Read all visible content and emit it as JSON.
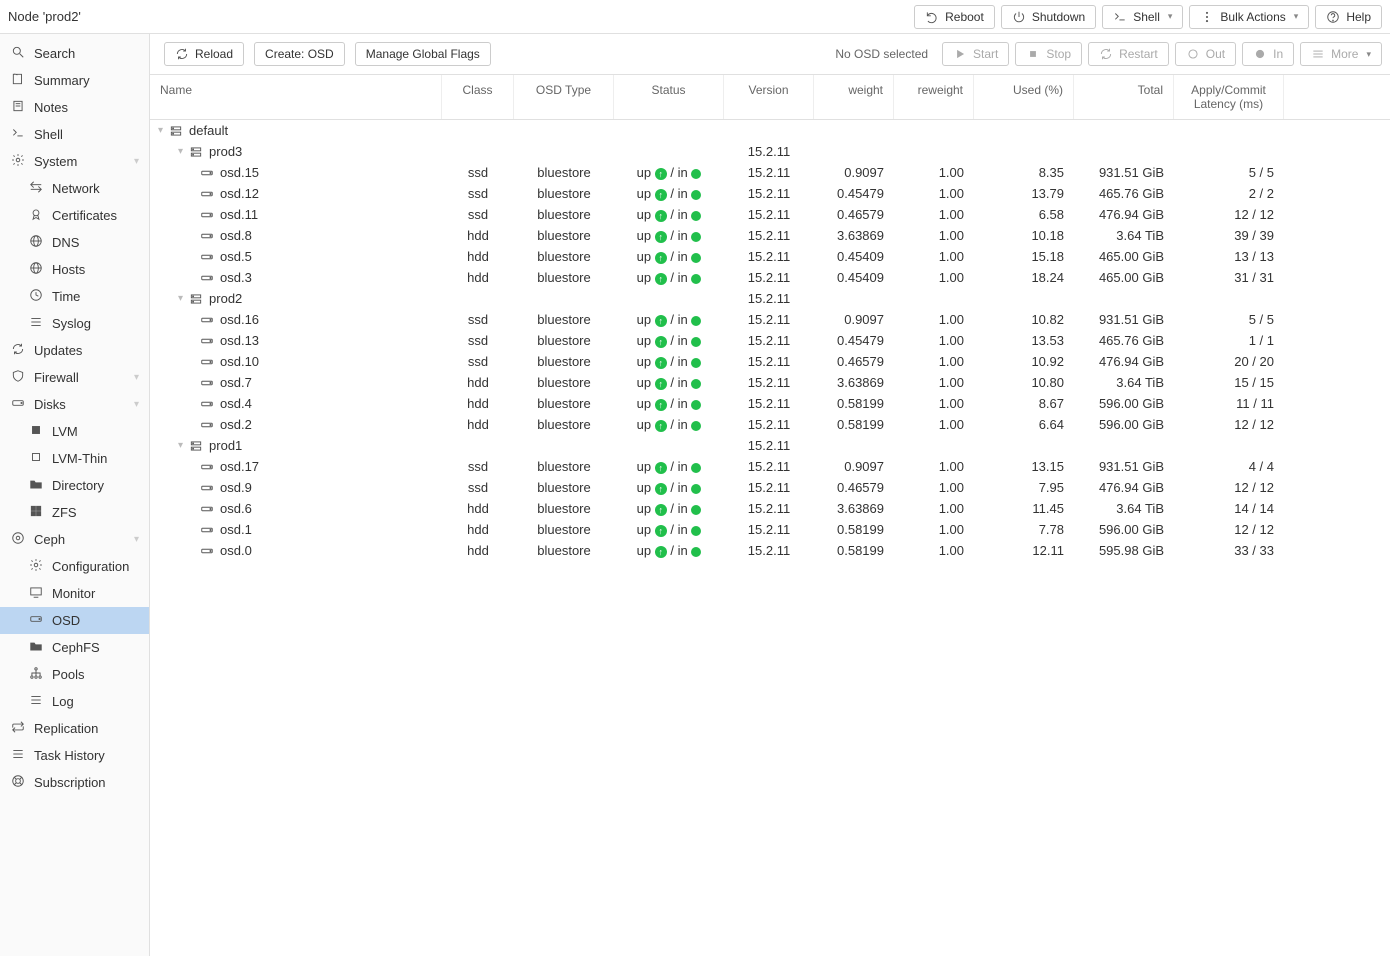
{
  "top": {
    "title": "Node 'prod2'",
    "reboot": "Reboot",
    "shutdown": "Shutdown",
    "shell": "Shell",
    "bulk": "Bulk Actions",
    "help": "Help"
  },
  "sidebar": [
    {
      "label": "Search",
      "lvl": 0,
      "icon": "search"
    },
    {
      "label": "Summary",
      "lvl": 0,
      "icon": "book"
    },
    {
      "label": "Notes",
      "lvl": 0,
      "icon": "note"
    },
    {
      "label": "Shell",
      "lvl": 0,
      "icon": "terminal"
    },
    {
      "label": "System",
      "lvl": 0,
      "icon": "gear",
      "expand": true
    },
    {
      "label": "Network",
      "lvl": 1,
      "icon": "network"
    },
    {
      "label": "Certificates",
      "lvl": 1,
      "icon": "cert"
    },
    {
      "label": "DNS",
      "lvl": 1,
      "icon": "globe"
    },
    {
      "label": "Hosts",
      "lvl": 1,
      "icon": "globe"
    },
    {
      "label": "Time",
      "lvl": 1,
      "icon": "clock"
    },
    {
      "label": "Syslog",
      "lvl": 1,
      "icon": "list"
    },
    {
      "label": "Updates",
      "lvl": 0,
      "icon": "refresh"
    },
    {
      "label": "Firewall",
      "lvl": 0,
      "icon": "shield",
      "expand": true
    },
    {
      "label": "Disks",
      "lvl": 0,
      "icon": "disk",
      "expand": true
    },
    {
      "label": "LVM",
      "lvl": 1,
      "icon": "square"
    },
    {
      "label": "LVM-Thin",
      "lvl": 1,
      "icon": "square-o"
    },
    {
      "label": "Directory",
      "lvl": 1,
      "icon": "folder"
    },
    {
      "label": "ZFS",
      "lvl": 1,
      "icon": "grid"
    },
    {
      "label": "Ceph",
      "lvl": 0,
      "icon": "ceph",
      "expand": true
    },
    {
      "label": "Configuration",
      "lvl": 1,
      "icon": "gear"
    },
    {
      "label": "Monitor",
      "lvl": 1,
      "icon": "tv"
    },
    {
      "label": "OSD",
      "lvl": 1,
      "icon": "disk",
      "selected": true
    },
    {
      "label": "CephFS",
      "lvl": 1,
      "icon": "folder"
    },
    {
      "label": "Pools",
      "lvl": 1,
      "icon": "sitemap"
    },
    {
      "label": "Log",
      "lvl": 1,
      "icon": "list"
    },
    {
      "label": "Replication",
      "lvl": 0,
      "icon": "retweet"
    },
    {
      "label": "Task History",
      "lvl": 0,
      "icon": "list"
    },
    {
      "label": "Subscription",
      "lvl": 0,
      "icon": "support"
    }
  ],
  "toolbar": {
    "reload": "Reload",
    "create": "Create: OSD",
    "manage": "Manage Global Flags",
    "status": "No OSD selected",
    "start": "Start",
    "stop": "Stop",
    "restart": "Restart",
    "out": "Out",
    "in": "In",
    "more": "More"
  },
  "columns": {
    "name": "Name",
    "class": "Class",
    "type": "OSD Type",
    "status": "Status",
    "version": "Version",
    "weight": "weight",
    "reweight": "reweight",
    "used": "Used (%)",
    "total": "Total",
    "latency": "Apply/Commit Latency (ms)"
  },
  "rows": [
    {
      "kind": "group",
      "lvl": 0,
      "name": "default"
    },
    {
      "kind": "group",
      "lvl": 1,
      "name": "prod3",
      "version": "15.2.11"
    },
    {
      "kind": "osd",
      "lvl": 2,
      "name": "osd.15",
      "class": "ssd",
      "type": "bluestore",
      "status": "up/in",
      "version": "15.2.11",
      "weight": "0.9097",
      "reweight": "1.00",
      "used": "8.35",
      "total": "931.51 GiB",
      "latency": "5 / 5"
    },
    {
      "kind": "osd",
      "lvl": 2,
      "name": "osd.12",
      "class": "ssd",
      "type": "bluestore",
      "status": "up/in",
      "version": "15.2.11",
      "weight": "0.45479",
      "reweight": "1.00",
      "used": "13.79",
      "total": "465.76 GiB",
      "latency": "2 / 2"
    },
    {
      "kind": "osd",
      "lvl": 2,
      "name": "osd.11",
      "class": "ssd",
      "type": "bluestore",
      "status": "up/in",
      "version": "15.2.11",
      "weight": "0.46579",
      "reweight": "1.00",
      "used": "6.58",
      "total": "476.94 GiB",
      "latency": "12 / 12"
    },
    {
      "kind": "osd",
      "lvl": 2,
      "name": "osd.8",
      "class": "hdd",
      "type": "bluestore",
      "status": "up/in",
      "version": "15.2.11",
      "weight": "3.63869",
      "reweight": "1.00",
      "used": "10.18",
      "total": "3.64 TiB",
      "latency": "39 / 39"
    },
    {
      "kind": "osd",
      "lvl": 2,
      "name": "osd.5",
      "class": "hdd",
      "type": "bluestore",
      "status": "up/in",
      "version": "15.2.11",
      "weight": "0.45409",
      "reweight": "1.00",
      "used": "15.18",
      "total": "465.00 GiB",
      "latency": "13 / 13"
    },
    {
      "kind": "osd",
      "lvl": 2,
      "name": "osd.3",
      "class": "hdd",
      "type": "bluestore",
      "status": "up/in",
      "version": "15.2.11",
      "weight": "0.45409",
      "reweight": "1.00",
      "used": "18.24",
      "total": "465.00 GiB",
      "latency": "31 / 31"
    },
    {
      "kind": "group",
      "lvl": 1,
      "name": "prod2",
      "version": "15.2.11"
    },
    {
      "kind": "osd",
      "lvl": 2,
      "name": "osd.16",
      "class": "ssd",
      "type": "bluestore",
      "status": "up/in",
      "version": "15.2.11",
      "weight": "0.9097",
      "reweight": "1.00",
      "used": "10.82",
      "total": "931.51 GiB",
      "latency": "5 / 5"
    },
    {
      "kind": "osd",
      "lvl": 2,
      "name": "osd.13",
      "class": "ssd",
      "type": "bluestore",
      "status": "up/in",
      "version": "15.2.11",
      "weight": "0.45479",
      "reweight": "1.00",
      "used": "13.53",
      "total": "465.76 GiB",
      "latency": "1 / 1"
    },
    {
      "kind": "osd",
      "lvl": 2,
      "name": "osd.10",
      "class": "ssd",
      "type": "bluestore",
      "status": "up/in",
      "version": "15.2.11",
      "weight": "0.46579",
      "reweight": "1.00",
      "used": "10.92",
      "total": "476.94 GiB",
      "latency": "20 / 20"
    },
    {
      "kind": "osd",
      "lvl": 2,
      "name": "osd.7",
      "class": "hdd",
      "type": "bluestore",
      "status": "up/in",
      "version": "15.2.11",
      "weight": "3.63869",
      "reweight": "1.00",
      "used": "10.80",
      "total": "3.64 TiB",
      "latency": "15 / 15"
    },
    {
      "kind": "osd",
      "lvl": 2,
      "name": "osd.4",
      "class": "hdd",
      "type": "bluestore",
      "status": "up/in",
      "version": "15.2.11",
      "weight": "0.58199",
      "reweight": "1.00",
      "used": "8.67",
      "total": "596.00 GiB",
      "latency": "11 / 11"
    },
    {
      "kind": "osd",
      "lvl": 2,
      "name": "osd.2",
      "class": "hdd",
      "type": "bluestore",
      "status": "up/in",
      "version": "15.2.11",
      "weight": "0.58199",
      "reweight": "1.00",
      "used": "6.64",
      "total": "596.00 GiB",
      "latency": "12 / 12"
    },
    {
      "kind": "group",
      "lvl": 1,
      "name": "prod1",
      "version": "15.2.11"
    },
    {
      "kind": "osd",
      "lvl": 2,
      "name": "osd.17",
      "class": "ssd",
      "type": "bluestore",
      "status": "up/in",
      "version": "15.2.11",
      "weight": "0.9097",
      "reweight": "1.00",
      "used": "13.15",
      "total": "931.51 GiB",
      "latency": "4 / 4"
    },
    {
      "kind": "osd",
      "lvl": 2,
      "name": "osd.9",
      "class": "ssd",
      "type": "bluestore",
      "status": "up/in",
      "version": "15.2.11",
      "weight": "0.46579",
      "reweight": "1.00",
      "used": "7.95",
      "total": "476.94 GiB",
      "latency": "12 / 12"
    },
    {
      "kind": "osd",
      "lvl": 2,
      "name": "osd.6",
      "class": "hdd",
      "type": "bluestore",
      "status": "up/in",
      "version": "15.2.11",
      "weight": "3.63869",
      "reweight": "1.00",
      "used": "11.45",
      "total": "3.64 TiB",
      "latency": "14 / 14"
    },
    {
      "kind": "osd",
      "lvl": 2,
      "name": "osd.1",
      "class": "hdd",
      "type": "bluestore",
      "status": "up/in",
      "version": "15.2.11",
      "weight": "0.58199",
      "reweight": "1.00",
      "used": "7.78",
      "total": "596.00 GiB",
      "latency": "12 / 12"
    },
    {
      "kind": "osd",
      "lvl": 2,
      "name": "osd.0",
      "class": "hdd",
      "type": "bluestore",
      "status": "up/in",
      "version": "15.2.11",
      "weight": "0.58199",
      "reweight": "1.00",
      "used": "12.11",
      "total": "595.98 GiB",
      "latency": "33 / 33"
    }
  ]
}
